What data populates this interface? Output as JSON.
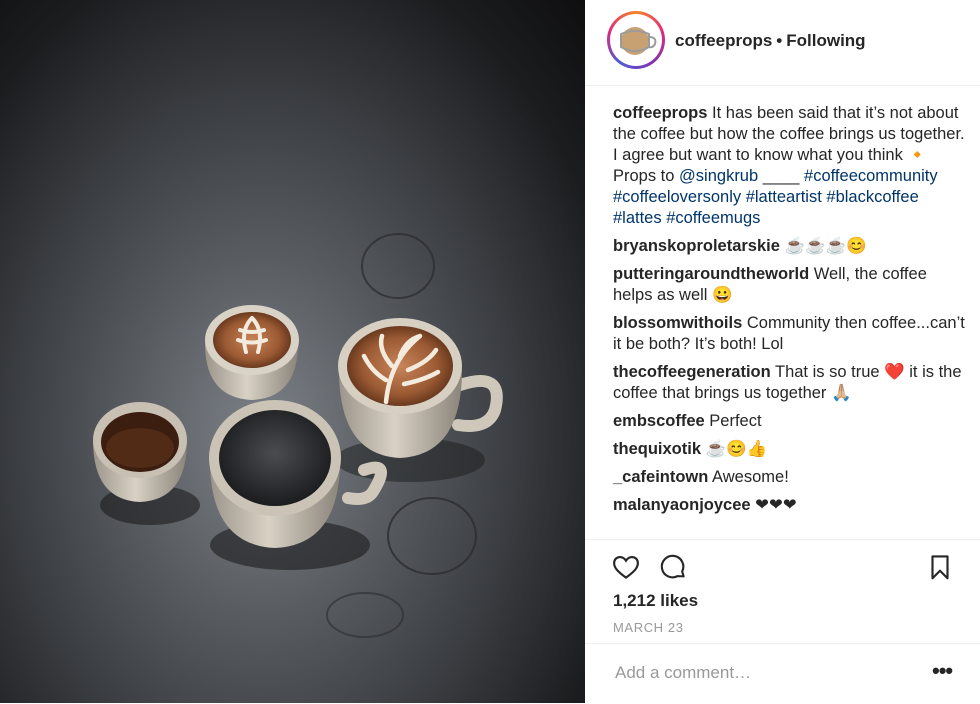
{
  "post": {
    "image_alt": "Coffee cups on dark table",
    "author": "coffeeprops",
    "separator": "•",
    "follow_status": "Following"
  },
  "caption": {
    "user": "coffeeprops",
    "text": "It has been said that it’s not about the coffee but how the coffee brings us together. I agree but want to know what you think 🔸 Props to ",
    "mention": "@singkrub",
    "after_mention": " ____ ",
    "hashtags": "#coffeecommunity #coffeeloversonly #latteartist #blackcoffee #lattes #coffeemugs"
  },
  "comments": [
    {
      "user": "bryanskoproletarskie",
      "text": "☕☕☕😊"
    },
    {
      "user": "putteringaroundtheworld",
      "text": "Well, the coffee helps as well 😀"
    },
    {
      "user": "blossomwithoils",
      "text": "Community then coffee...can’t it be both? It’s both! Lol"
    },
    {
      "user": "thecoffeegeneration",
      "text": "That is so true ❤️ it is the coffee that brings us together 🙏🏼"
    },
    {
      "user": "embscoffee",
      "text": "Perfect"
    },
    {
      "user": "thequixotik",
      "text": "☕😊👍"
    },
    {
      "user": "_cafeintown",
      "text": "Awesome!"
    },
    {
      "user": "malanyaonjoycee",
      "text": "❤❤❤"
    }
  ],
  "actions": {
    "like_icon": "heart-outline-icon",
    "comment_icon": "comment-bubble-icon",
    "save_icon": "bookmark-icon"
  },
  "likes": "1,212 likes",
  "date": "MARCH 23",
  "add_comment": {
    "placeholder": "Add a comment…",
    "more_label": "•••"
  },
  "colors": {
    "link": "#003569",
    "muted": "#999999",
    "text": "#262626"
  }
}
